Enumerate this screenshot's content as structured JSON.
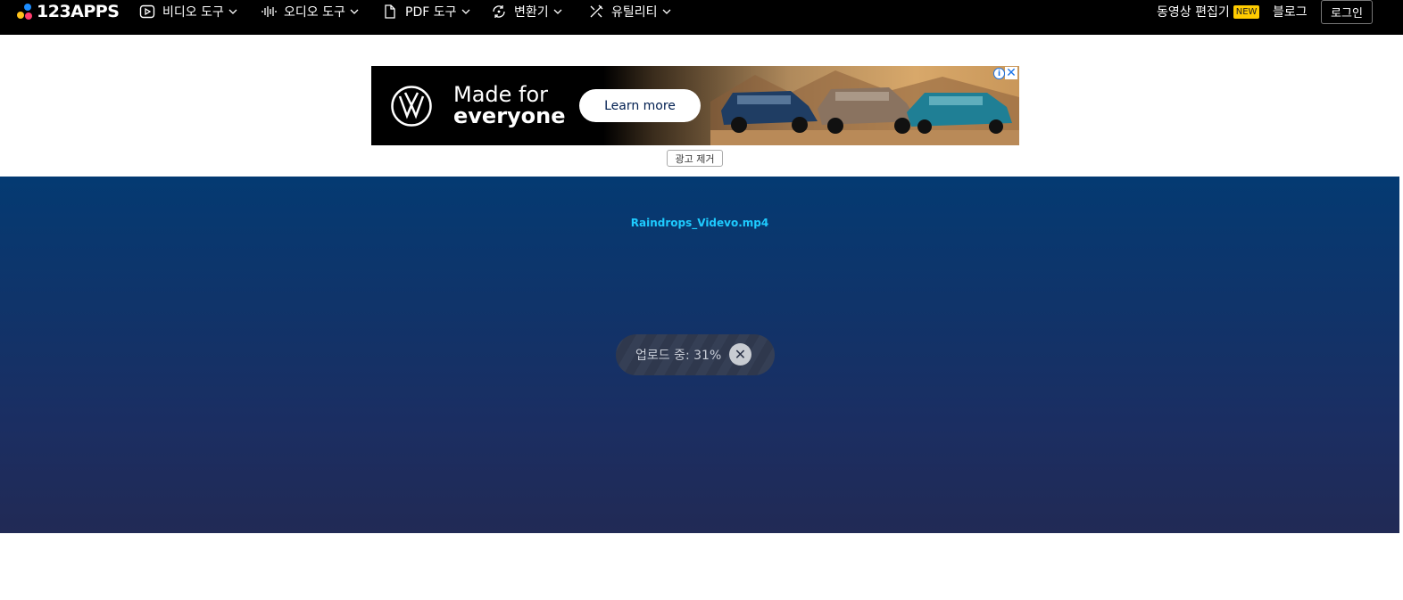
{
  "header": {
    "logo_text": "123APPS",
    "nav": [
      {
        "label": "비디오 도구",
        "icon": "video-play-icon"
      },
      {
        "label": "오디오 도구",
        "icon": "audio-wave-icon"
      },
      {
        "label": "PDF 도구",
        "icon": "document-icon"
      },
      {
        "label": "변환기",
        "icon": "convert-icon"
      },
      {
        "label": "유틸리티",
        "icon": "tools-icon"
      }
    ],
    "video_editor_label": "동영상 편집기",
    "new_badge": "NEW",
    "blog_label": "블로그",
    "login_label": "로그인"
  },
  "ad": {
    "headline_line1": "Made for",
    "headline_line2": "everyone",
    "cta_label": "Learn more",
    "info_symbol": "i",
    "close_symbol": "✕",
    "remove_ad_label": "광고 제거"
  },
  "tool": {
    "file_name": "Raindrops_Videvo.mp4",
    "upload_status": "업로드 중: 31%",
    "upload_progress_percent": 31,
    "cancel_symbol": "✕"
  },
  "colors": {
    "header_bg": "#000000",
    "tool_bg_top": "#043a72",
    "tool_bg_bottom": "#212a55",
    "file_name": "#1ecbff",
    "new_badge": "#ffcc00"
  }
}
